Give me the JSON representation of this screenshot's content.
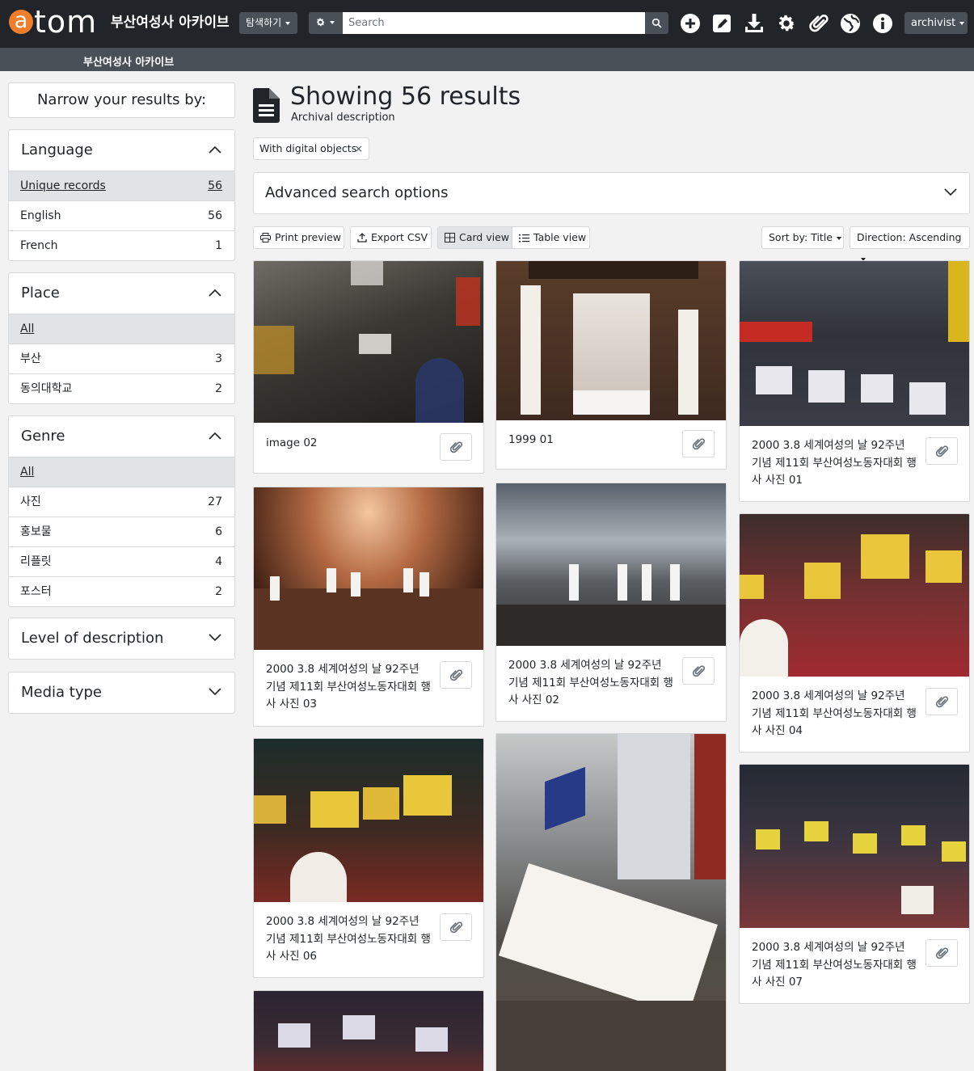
{
  "app": {
    "logo_a": "a",
    "logo_rest": "tom",
    "site_title": "부산여성사 아카이브",
    "browse_label": "탐색하기",
    "search_placeholder": "Search",
    "user_label": "archivist",
    "repository_link": "부산여성사 아카이브",
    "accent_color": "#ef7e2b",
    "navbar_color": "#212529",
    "subbar_color": "#495057"
  },
  "nav_icons": [
    "add-icon",
    "edit-icon",
    "import-icon",
    "settings-icon",
    "clipboard-icon",
    "language-icon",
    "info-icon"
  ],
  "sidebar": {
    "narrow_label": "Narrow your results by:",
    "facets": {
      "language": {
        "title": "Language",
        "rows": [
          {
            "label": "Unique records",
            "count": "56"
          },
          {
            "label": "English",
            "count": "56"
          },
          {
            "label": "French",
            "count": "1"
          }
        ]
      },
      "place": {
        "title": "Place",
        "rows": [
          {
            "label": "All",
            "count": ""
          },
          {
            "label": "부산",
            "count": "3"
          },
          {
            "label": "동의대학교",
            "count": "2"
          }
        ]
      },
      "genre": {
        "title": "Genre",
        "rows": [
          {
            "label": "All",
            "count": ""
          },
          {
            "label": "사진",
            "count": "27"
          },
          {
            "label": "홍보물",
            "count": "6"
          },
          {
            "label": "리플릿",
            "count": "4"
          },
          {
            "label": "포스터",
            "count": "2"
          }
        ]
      },
      "level": {
        "title": "Level of description"
      },
      "media": {
        "title": "Media type"
      }
    }
  },
  "main": {
    "title": "Showing 56 results",
    "subtitle": "Archival description",
    "filter_tag": "With digital objects",
    "filter_remove": "×",
    "advanced_label": "Advanced search options",
    "toolbar": {
      "print": "Print preview",
      "export": "Export CSV",
      "card_view": "Card view",
      "table_view": "Table view",
      "sort": "Sort by: Title",
      "direction": "Direction: Ascending"
    },
    "cards": [
      {
        "title": "image 02"
      },
      {
        "title": "1999 01"
      },
      {
        "title": "2000 3.8 세계여성의 날 92주년 기념 제11회 부산여성노동자대회 행사 사진 01"
      },
      {
        "title": "2000 3.8 세계여성의 날 92주년 기념 제11회 부산여성노동자대회 행사 사진 03"
      },
      {
        "title": "2000 3.8 세계여성의 날 92주년 기념 제11회 부산여성노동자대회 행사 사진 02"
      },
      {
        "title": "2000 3.8 세계여성의 날 92주년 기념 제11회 부산여성노동자대회 행사 사진 04"
      },
      {
        "title": "2000 3.8 세계여성의 날 92주년 기념 제11회 부산여성노동자대회 행사 사진 06"
      },
      {
        "title": ""
      },
      {
        "title": "2000 3.8 세계여성의 날 92주년 기념 제11회 부산여성노동자대회 행사 사진 07"
      },
      {
        "title": ""
      }
    ]
  }
}
